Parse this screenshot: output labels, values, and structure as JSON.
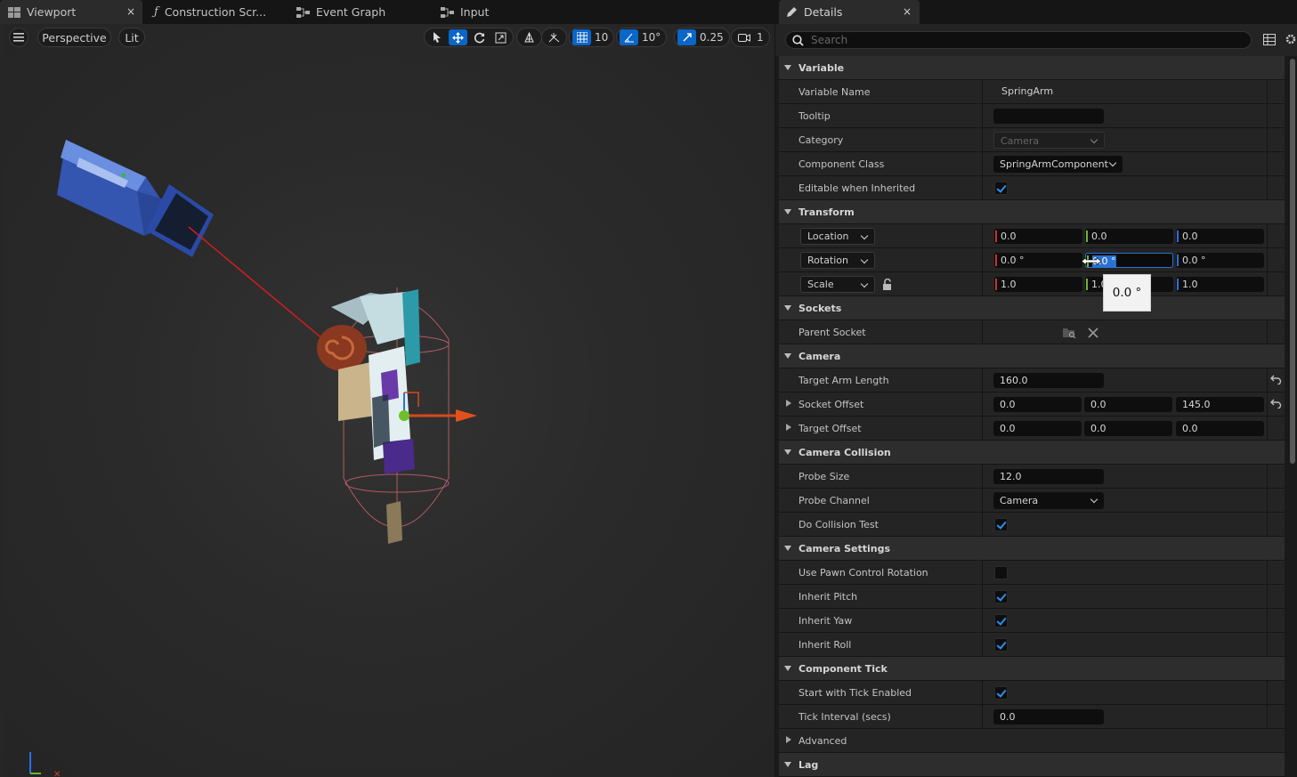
{
  "left_tabs": [
    {
      "label": "Viewport",
      "close": "×"
    },
    {
      "label": "Construction Scr..."
    },
    {
      "label": "Event Graph"
    },
    {
      "label": "Input"
    }
  ],
  "viewport_toolbar": {
    "menu_icon": "hamburger-menu-icon",
    "view_mode": "Perspective",
    "lighting": "Lit",
    "grid_snap": "10",
    "rotation_snap": "10°",
    "scale_snap": "0.25",
    "camera_speed": "1"
  },
  "details": {
    "tab_label": "Details",
    "tab_close": "×",
    "search_placeholder": "Search",
    "categories": {
      "variable": "Variable",
      "transform": "Transform",
      "sockets": "Sockets",
      "camera": "Camera",
      "camera_collision": "Camera Collision",
      "camera_settings": "Camera Settings",
      "component_tick": "Component Tick",
      "advanced": "Advanced",
      "lag": "Lag"
    },
    "props": {
      "variable_name": {
        "label": "Variable Name",
        "value": "SpringArm"
      },
      "tooltip": {
        "label": "Tooltip",
        "value": ""
      },
      "category": {
        "label": "Category",
        "value": "Camera"
      },
      "component_class": {
        "label": "Component Class",
        "value": "SpringArmComponent"
      },
      "editable_when_inherited": {
        "label": "Editable when Inherited",
        "checked": true
      },
      "location": {
        "label": "Location",
        "x": "0.0",
        "y": "0.0",
        "z": "0.0"
      },
      "rotation": {
        "label": "Rotation",
        "x": "0.0 °",
        "y": "0.0 °",
        "z": "0.0 °"
      },
      "scale": {
        "label": "Scale",
        "x": "1.0",
        "y": "1.0",
        "z": "1.0"
      },
      "parent_socket": {
        "label": "Parent Socket"
      },
      "target_arm_length": {
        "label": "Target Arm Length",
        "value": "160.0"
      },
      "socket_offset": {
        "label": "Socket Offset",
        "x": "0.0",
        "y": "0.0",
        "z": "145.0"
      },
      "target_offset": {
        "label": "Target Offset",
        "x": "0.0",
        "y": "0.0",
        "z": "0.0"
      },
      "probe_size": {
        "label": "Probe Size",
        "value": "12.0"
      },
      "probe_channel": {
        "label": "Probe Channel",
        "value": "Camera"
      },
      "do_collision_test": {
        "label": "Do Collision Test",
        "checked": true
      },
      "use_pawn_control_rotation": {
        "label": "Use Pawn Control Rotation",
        "checked": false
      },
      "inherit_pitch": {
        "label": "Inherit Pitch",
        "checked": true
      },
      "inherit_yaw": {
        "label": "Inherit Yaw",
        "checked": true
      },
      "inherit_roll": {
        "label": "Inherit Roll",
        "checked": true
      },
      "start_with_tick_enabled": {
        "label": "Start with Tick Enabled",
        "checked": true
      },
      "tick_interval": {
        "label": "Tick Interval (secs)",
        "value": "0.0"
      }
    },
    "tooltip_popup": "0.0 °"
  },
  "colors": {
    "accent": "#0a66c8",
    "axis_x": "#c8332a",
    "axis_y": "#6cb531",
    "axis_z": "#2f6fe0"
  }
}
